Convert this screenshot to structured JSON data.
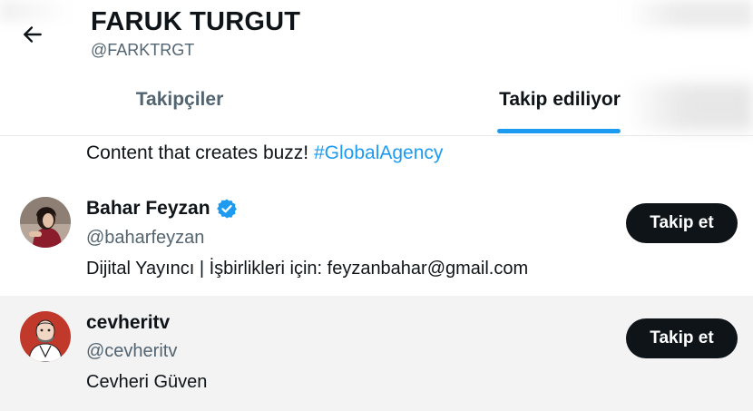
{
  "header": {
    "back_icon": "arrow-left-icon",
    "title": "FARUK TURGUT",
    "handle": "@FARKTRGT"
  },
  "tabs": [
    {
      "label": "Takipçiler",
      "active": false
    },
    {
      "label": "Takip ediliyor",
      "active": true
    }
  ],
  "previous_bio": {
    "text": "Content that creates buzz! ",
    "hashtag": "#GlobalAgency"
  },
  "users": [
    {
      "name": "Bahar Feyzan",
      "verified": true,
      "handle": "@baharfeyzan",
      "bio": "Dijital Yayıncı | İşbirlikleri için: feyzanbahar@gmail.com",
      "button_label": "Takip et"
    },
    {
      "name": "cevheritv",
      "verified": false,
      "handle": "@cevheritv",
      "bio": "Cevheri Güven",
      "button_label": "Takip et"
    }
  ],
  "colors": {
    "accent": "#1d9bf0",
    "text_primary": "#0f1419",
    "text_secondary": "#536471",
    "button_bg": "#0f1419",
    "hover_row_bg": "#f3f3f3"
  }
}
